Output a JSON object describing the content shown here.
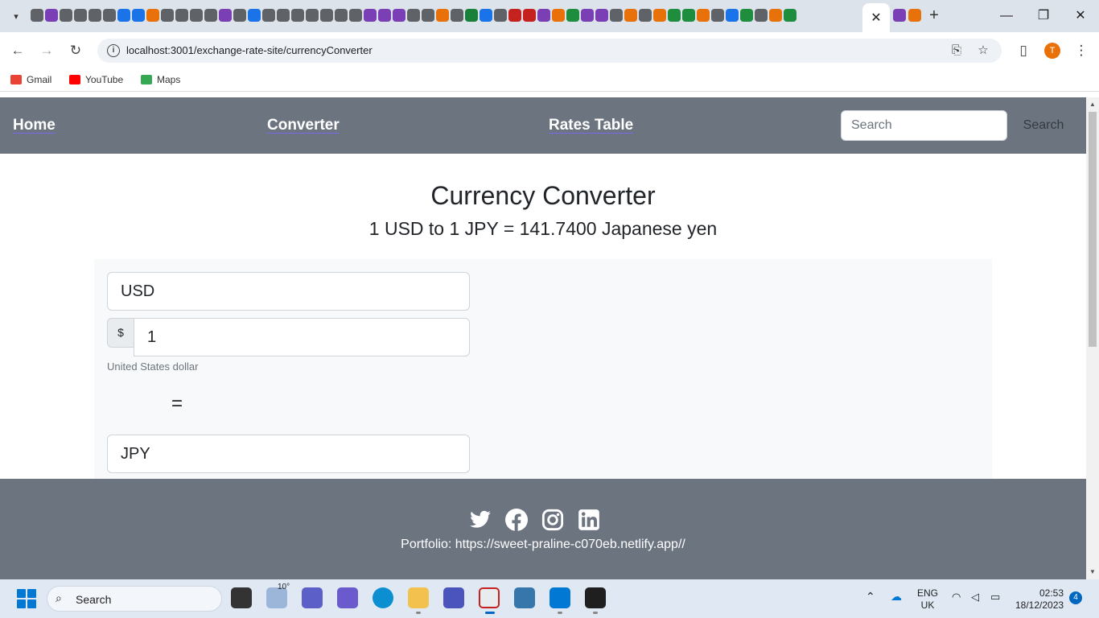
{
  "browser": {
    "url": "localhost:3001/exchange-rate-site/currencyConverter",
    "profile_initial": "T",
    "bookmarks": [
      {
        "label": "Gmail",
        "icon": "gmail-icon",
        "color": "#ea4335"
      },
      {
        "label": "YouTube",
        "icon": "youtube-icon",
        "color": "#ff0000"
      },
      {
        "label": "Maps",
        "icon": "maps-icon",
        "color": "#34a853"
      }
    ]
  },
  "navbar": {
    "home": "Home",
    "converter": "Converter",
    "rates_table": "Rates Table",
    "search_placeholder": "Search",
    "search_button": "Search"
  },
  "main": {
    "title": "Currency Converter",
    "rate_line": "1 USD to 1 JPY = 141.7400 Japanese yen",
    "from_currency": "USD",
    "currency_symbol": "$",
    "amount": "1",
    "from_currency_name": "United States dollar",
    "equals": "=",
    "to_currency": "JPY"
  },
  "footer": {
    "social": [
      "twitter-icon",
      "facebook-icon",
      "instagram-icon",
      "linkedin-icon"
    ],
    "portfolio": "Portfolio: https://sweet-praline-c070eb.netlify.app//"
  },
  "taskbar": {
    "search_label": "Search",
    "weather": "10°",
    "language": "ENG",
    "region": "UK",
    "time": "02:53",
    "date": "18/12/2023",
    "notification_count": "4"
  },
  "colors": {
    "navbar_bg": "#6c7480",
    "link_underline": "#7b68ee",
    "panel_bg": "#f8f9fa"
  }
}
